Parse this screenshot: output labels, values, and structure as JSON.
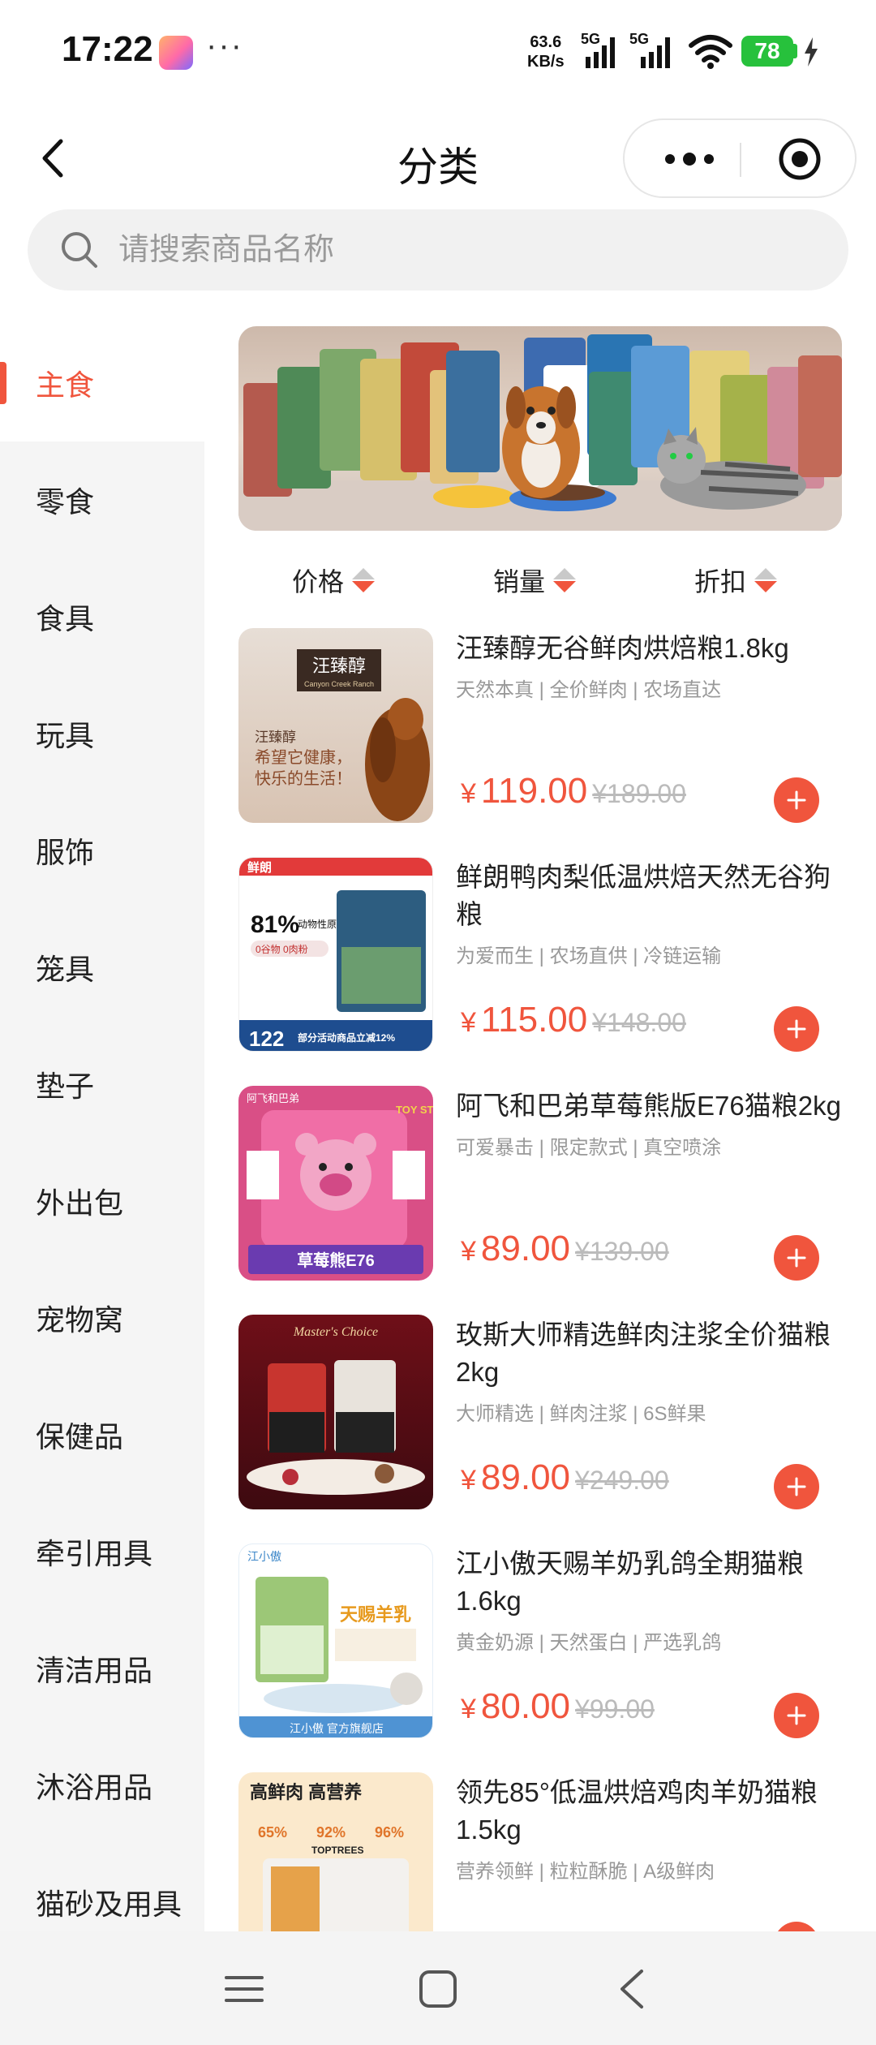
{
  "status_bar": {
    "time": "17:22",
    "more_dots": "···",
    "net_speed_value": "63.6",
    "net_speed_unit": "KB/s",
    "sim1_label": "5G",
    "sim2_label": "5G",
    "battery": "78"
  },
  "header": {
    "title": "分类"
  },
  "search": {
    "placeholder": "请搜索商品名称"
  },
  "sidebar": {
    "items": [
      {
        "label": "主食",
        "active": true
      },
      {
        "label": "零食"
      },
      {
        "label": "食具"
      },
      {
        "label": "玩具"
      },
      {
        "label": "服饰"
      },
      {
        "label": "笼具"
      },
      {
        "label": "垫子"
      },
      {
        "label": "外出包"
      },
      {
        "label": "宠物窝"
      },
      {
        "label": "保健品"
      },
      {
        "label": "牵引用具"
      },
      {
        "label": "清洁用品"
      },
      {
        "label": "沐浴用品"
      },
      {
        "label": "猫砂及用具"
      }
    ]
  },
  "sort": {
    "price": "价格",
    "sales": "销量",
    "discount": "折扣"
  },
  "products": [
    {
      "title": "汪臻醇无谷鲜肉烘焙粮1.8kg",
      "tags": "天然本真 | 全价鲜肉 | 农场直达",
      "currency": "¥",
      "price": "119.00",
      "old_price": "¥189.00",
      "thumb": {
        "brand": "汪臻醇",
        "sub": "Canyon Creek Ranch",
        "slogan1": "汪臻醇",
        "slogan2": "希望它健康，",
        "slogan3": "快乐的生活！"
      }
    },
    {
      "title": "鲜朗鸭肉梨低温烘焙天然无谷狗粮",
      "tags": "为爱而生 | 农场直供 | 冷链运输",
      "currency": "¥",
      "price": "115.00",
      "old_price": "¥148.00",
      "thumb": {
        "brand": "鲜朗",
        "percent": "81%",
        "percent_label": "动物性原料",
        "grain": "0谷物 0肉粉",
        "price_tag": "122",
        "promo": "部分活动商品立减12%"
      }
    },
    {
      "title": "阿飞和巴弟草莓熊版E76猫粮2kg",
      "tags": "可爱暴击 | 限定款式 | 真空喷涂",
      "currency": "¥",
      "price": "89.00",
      "old_price": "¥139.00",
      "thumb": {
        "brand": "阿飞和巴弟",
        "logo": "TOY STORY",
        "banner": "草莓熊E76"
      }
    },
    {
      "title": "玫斯大师精选鲜肉注浆全价猫粮2kg",
      "tags": "大师精选 | 鲜肉注浆 | 6S鲜果",
      "currency": "¥",
      "price": "89.00",
      "old_price": "¥249.00",
      "thumb": {
        "script": "Master's Choice"
      }
    },
    {
      "title": "江小傲天赐羊奶乳鸽全期猫粮1.6kg",
      "tags": "黄金奶源 | 天然蛋白 | 严选乳鸽",
      "currency": "¥",
      "price": "80.00",
      "old_price": "¥99.00",
      "thumb": {
        "brand": "江小傲",
        "headline": "天赐羊乳",
        "footer": "江小傲 官方旗舰店"
      }
    },
    {
      "title": "领先85°低温烘焙鸡肉羊奶猫粮1.5kg",
      "tags": "营养领鲜 | 粒粒酥脆 | A级鲜肉",
      "currency": "¥",
      "price": "",
      "old_price": "",
      "thumb": {
        "headline": "高鲜肉 高营养",
        "stat1": "65%",
        "stat2": "92%",
        "stat3": "96%",
        "brand": "TOPTREES"
      }
    }
  ],
  "colors": {
    "accent": "#f0553d",
    "sidebar_bg": "#f5f5f5",
    "battery": "#27c13c"
  }
}
